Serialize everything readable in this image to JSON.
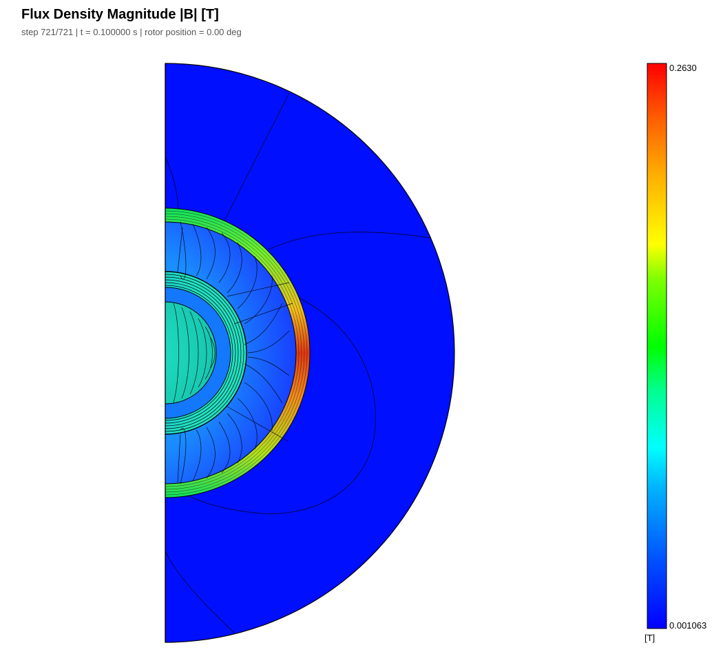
{
  "header": {
    "title": "Flux Density Magnitude |B|  [T]",
    "subtitle": "step 721/721  |  t = 0.100000 s  |  rotor position = 0.00 deg"
  },
  "colorbar": {
    "max_label": "0.2630",
    "min_label": "0.001063",
    "unit_label": "[T]",
    "max_value": 0.263,
    "min_value": 0.001063,
    "colormap": [
      "#0000ff",
      "#0080ff",
      "#00ffff",
      "#00ff80",
      "#00ff00",
      "#80ff00",
      "#ffff00",
      "#ff8000",
      "#ff0000"
    ]
  },
  "colors": {
    "background_field": "#0010ff",
    "rotor_core": "#1ecfb0",
    "airgap_ring_hot": "#e8551e",
    "outline": "#000000"
  }
}
